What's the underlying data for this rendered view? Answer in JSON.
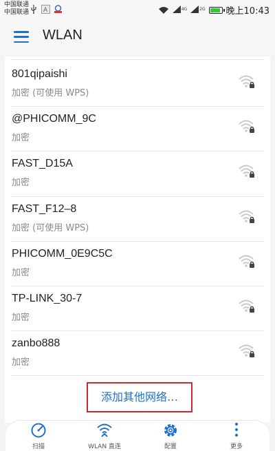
{
  "status_bar": {
    "carrier_1": "中国联通",
    "carrier_2": "中国联通",
    "net_1": "4G",
    "net_2": "2G",
    "time": "晚上10:43",
    "battery_color": "#37c837"
  },
  "header": {
    "title": "WLAN",
    "accent": "#1f6fd1"
  },
  "networks": [
    {
      "name": "801qipaishi",
      "security": "加密 (可使用 WPS)",
      "icon": "wifi-locked-icon"
    },
    {
      "name": "@PHICOMM_9C",
      "security": "加密",
      "icon": "wifi-locked-icon"
    },
    {
      "name": "FAST_D15A",
      "security": "加密",
      "icon": "wifi-locked-icon"
    },
    {
      "name": "FAST_F12–8",
      "security": "加密 (可使用 WPS)",
      "icon": "wifi-locked-icon"
    },
    {
      "name": "PHICOMM_0E9C5C",
      "security": "加密",
      "icon": "wifi-locked-icon"
    },
    {
      "name": "TP-LINK_30-7",
      "security": "加密",
      "icon": "wifi-locked-icon"
    },
    {
      "name": "zanbo888",
      "security": "加密",
      "icon": "wifi-locked-icon"
    }
  ],
  "add_network": {
    "label": "添加其他网络…",
    "highlight_color": "#d0262c"
  },
  "bottom_tabs": [
    {
      "label": "扫描",
      "icon": "scan-icon"
    },
    {
      "label": "WLAN 直连",
      "icon": "wlan-direct-icon"
    },
    {
      "label": "配置",
      "icon": "gear-icon"
    },
    {
      "label": "更多",
      "icon": "more-icon"
    }
  ]
}
